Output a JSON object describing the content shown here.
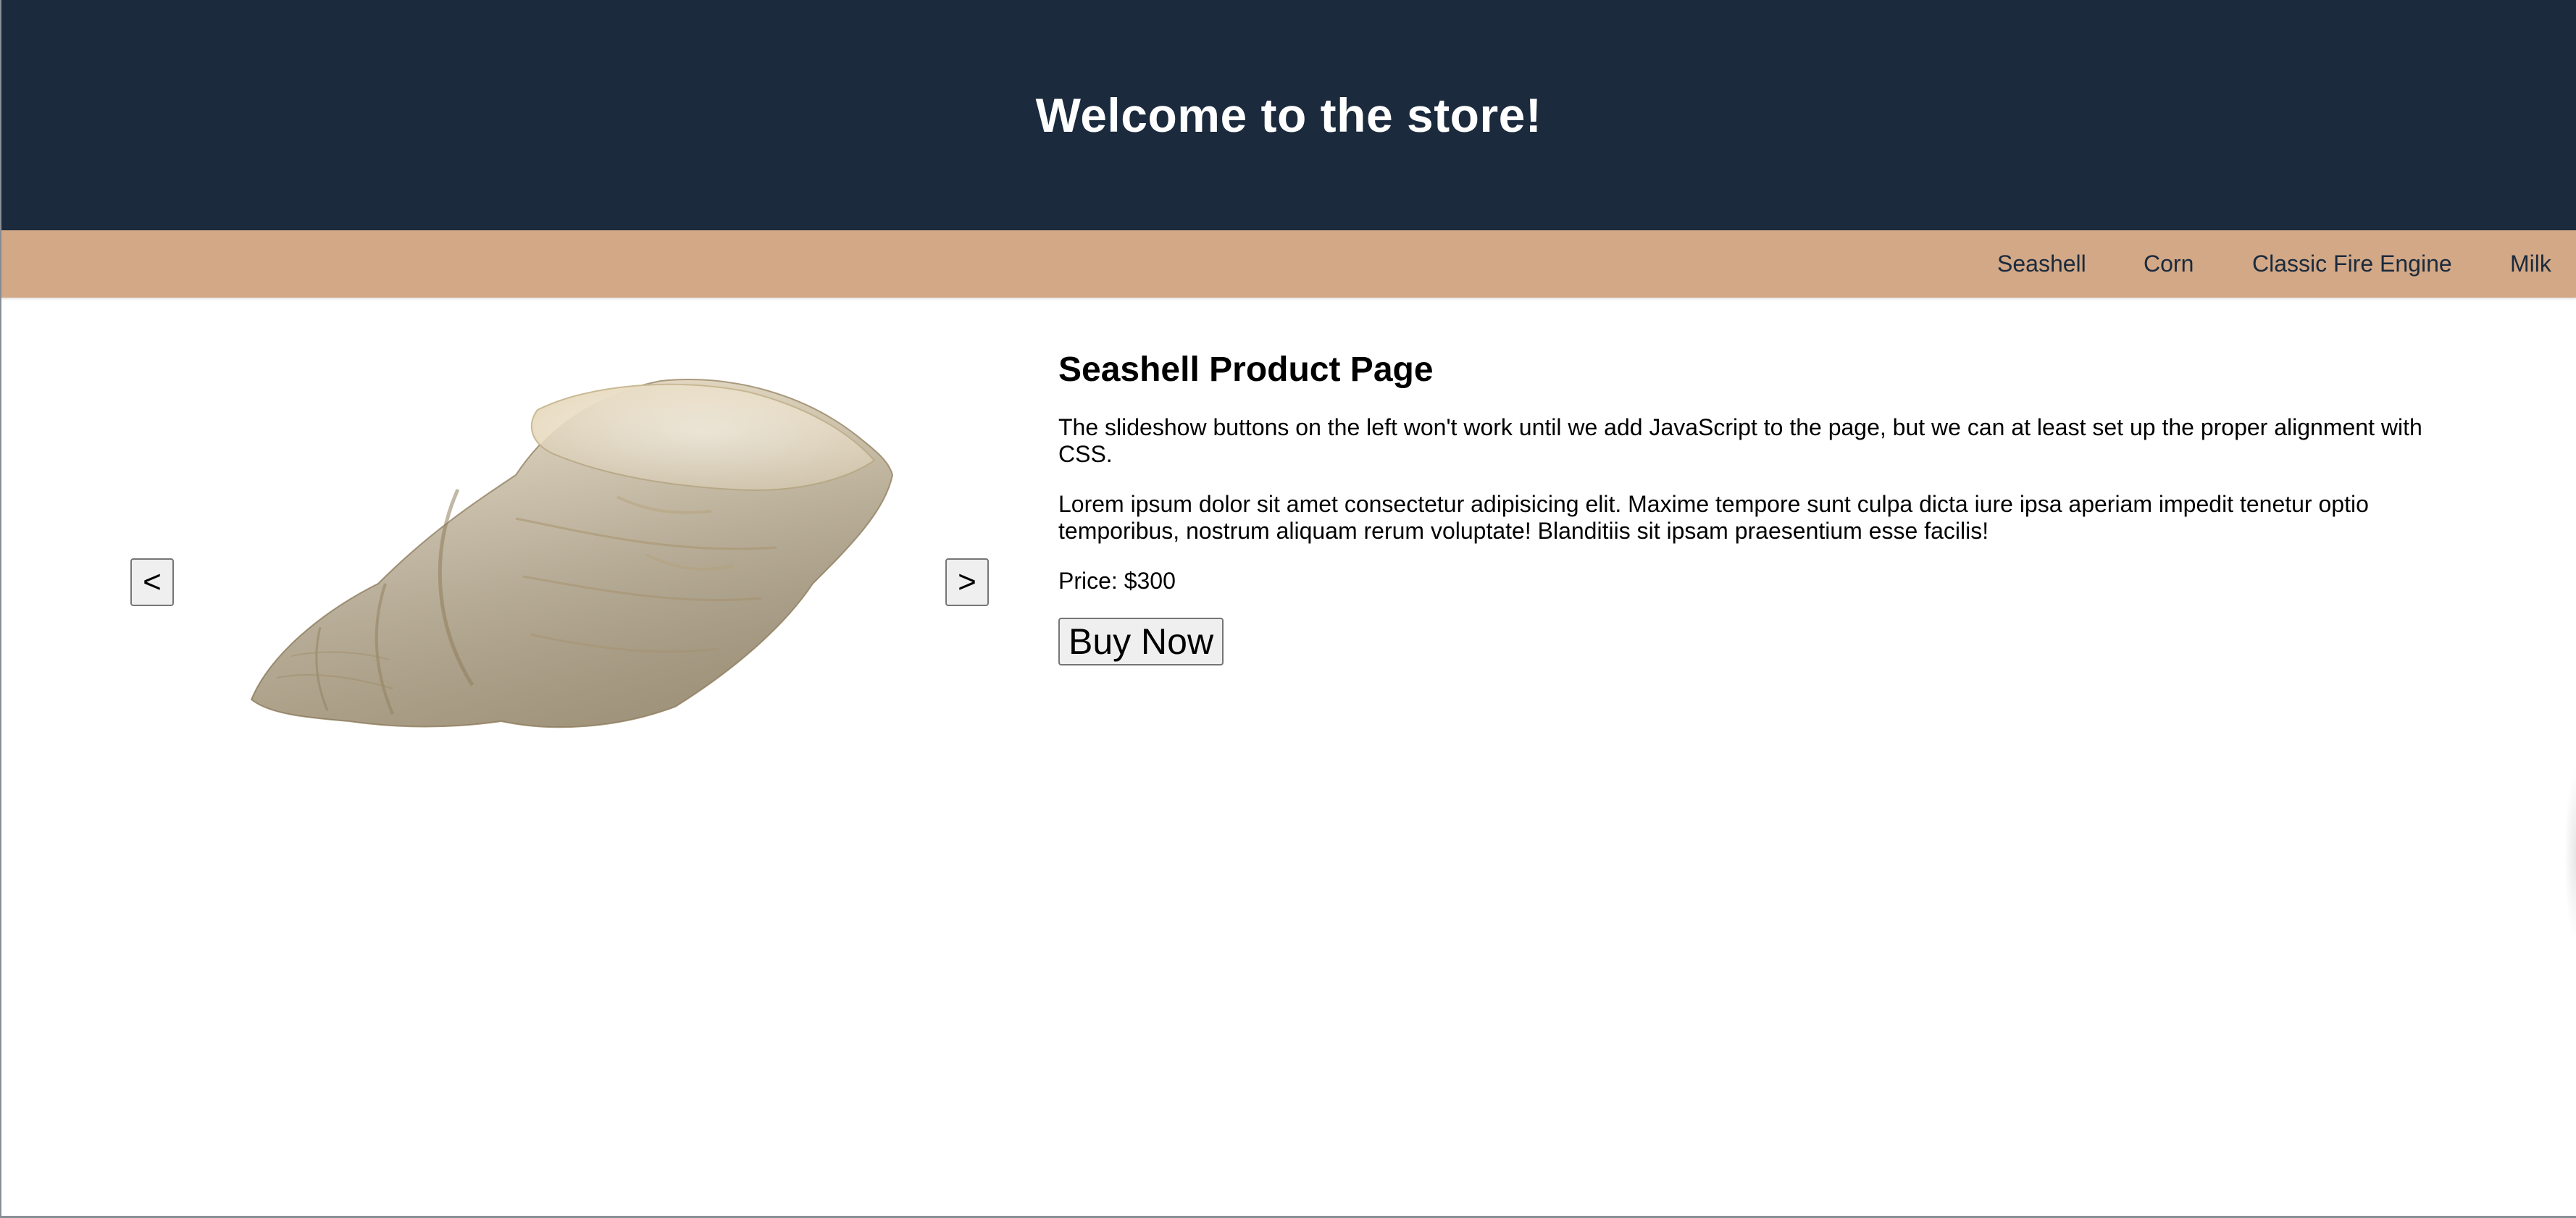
{
  "header": {
    "title": "Welcome to the store!"
  },
  "nav": {
    "items": [
      {
        "label": "Seashell"
      },
      {
        "label": "Corn"
      },
      {
        "label": "Classic Fire Engine"
      },
      {
        "label": "Milk"
      }
    ]
  },
  "slideshow": {
    "prev_label": "<",
    "next_label": ">",
    "image_alt": "seashell-photo"
  },
  "product": {
    "title": "Seashell Product Page",
    "description_1": "The slideshow buttons on the left won't work until we add JavaScript to the page, but we can at least set up the proper alignment with CSS.",
    "description_2": "Lorem ipsum dolor sit amet consectetur adipisicing elit. Maxime tempore sunt culpa dicta iure ipsa aperiam impedit tenetur optio temporibus, nostrum aliquam rerum voluptate! Blanditiis sit ipsam praesentium esse facilis!",
    "price": "Price: $300",
    "buy_label": "Buy Now"
  },
  "colors": {
    "header_bg": "#1b2a3d",
    "nav_bg": "#d2a886",
    "nav_text": "#1b2a3d"
  }
}
